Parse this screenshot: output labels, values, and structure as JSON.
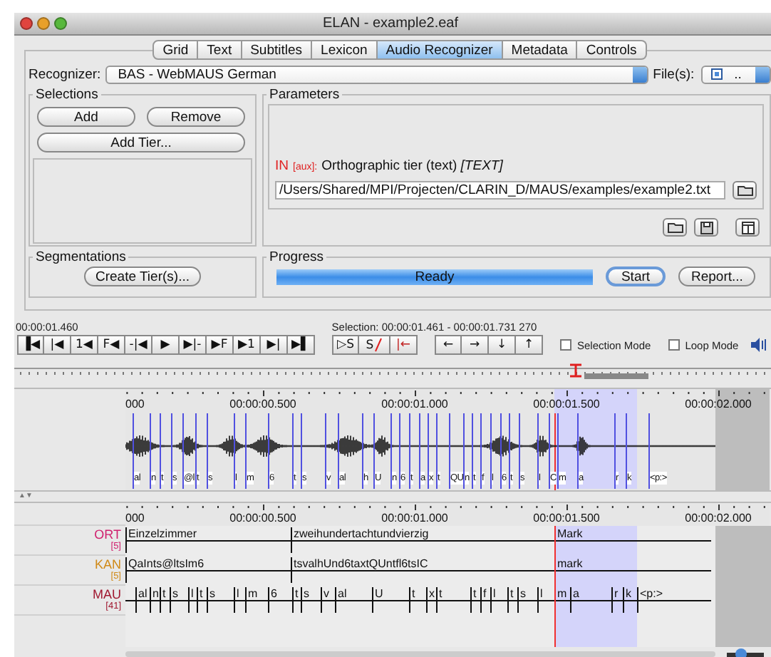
{
  "window": {
    "title": "ELAN - example2.eaf"
  },
  "tabs": [
    {
      "label": "Grid",
      "selected": false
    },
    {
      "label": "Text",
      "selected": false
    },
    {
      "label": "Subtitles",
      "selected": false
    },
    {
      "label": "Lexicon",
      "selected": false
    },
    {
      "label": "Audio Recognizer",
      "selected": true
    },
    {
      "label": "Metadata",
      "selected": false
    },
    {
      "label": "Controls",
      "selected": false
    }
  ],
  "recognizer": {
    "label": "Recognizer:",
    "value": "BAS - WebMAUS German",
    "files_label": "File(s):",
    "files_checked": true,
    "files_value": ".."
  },
  "selections": {
    "title": "Selections",
    "buttons": [
      "Add",
      "Remove",
      "Add Tier..."
    ]
  },
  "parameters": {
    "title": "Parameters",
    "io_tag": "IN",
    "aux_tag": "[aux]:",
    "description": "Orthographic tier (text) *[TEXT]*",
    "path": "/Users/Shared/MPI/Projecten/CLARIN_D/MAUS/examples/example2.txt"
  },
  "segmentations": {
    "title": "Segmentations",
    "button": "Create Tier(s)..."
  },
  "progress": {
    "title": "Progress",
    "level": 1,
    "status": "Ready",
    "start": "Start",
    "report": "Report..."
  },
  "media_time": "00:00:01.460",
  "selection_info": "Selection: 00:00:01.461 - 00:00:01.731  270",
  "transport": [
    "▐◀",
    "|◀",
    "1◀",
    "F◀",
    "-|◀",
    "▶",
    "▶|-",
    "▶F",
    "▶1",
    "▶|",
    "▶▌"
  ],
  "selection_tools": [
    {
      "label": "▷S",
      "kind": "play"
    },
    {
      "label": "S",
      "kind": "clear"
    },
    {
      "label": "|←",
      "kind": "begin"
    }
  ],
  "navigation": [
    "←",
    "→",
    "↓",
    "↑"
  ],
  "options": [
    {
      "label": "Selection Mode",
      "checked": false
    },
    {
      "label": "Loop Mode",
      "checked": false
    }
  ],
  "waveform": {
    "ruler": [
      "000",
      "00:00:00.500",
      "00:00:01.000",
      "00:00:01.500",
      "00:00:02.000"
    ],
    "labels": [
      "al",
      "n",
      "t",
      "s",
      "@l",
      "t",
      "s",
      "l",
      "m",
      "6",
      "t",
      "s",
      "v",
      "al",
      "h",
      "U",
      "n",
      "6",
      "t",
      "a",
      "x",
      "t",
      "QU",
      "n",
      "t",
      "f",
      "l",
      "6",
      "t",
      "s",
      "l",
      "C",
      "m",
      "a",
      "r",
      "k",
      "<p:>"
    ]
  },
  "tier_sort": "▲▼",
  "zoom": {
    "level": 0.4
  },
  "timeline": {
    "ruler": [
      "000",
      "00:00:00.500",
      "00:00:01.000",
      "00:00:01.500",
      "00:00:02.000"
    ],
    "tiers": [
      {
        "name": "ORT",
        "count": "[5]",
        "color": "#d0206e",
        "annotations": [
          "Einzelzimmer",
          "zweihundertachtundvierzig",
          "Mark"
        ]
      },
      {
        "name": "KAN",
        "count": "[5]",
        "color": "#d08a18",
        "annotations": [
          "QaInts@ltsIm6",
          "tsvalhUnd6taxtQUntfl6tsIC",
          "mark"
        ]
      },
      {
        "name": "MAU",
        "count": "[41]",
        "color": "#a01830",
        "annotations": [
          "al",
          "n",
          "t",
          "s",
          "l",
          "t",
          "s",
          "l",
          "m",
          "6",
          "t",
          "s",
          "v",
          "al",
          "U",
          "t",
          "x",
          "t",
          "t",
          "f",
          "l",
          "t",
          "s",
          "l",
          "m",
          "a",
          "r",
          "k",
          "<p:>"
        ]
      }
    ]
  }
}
